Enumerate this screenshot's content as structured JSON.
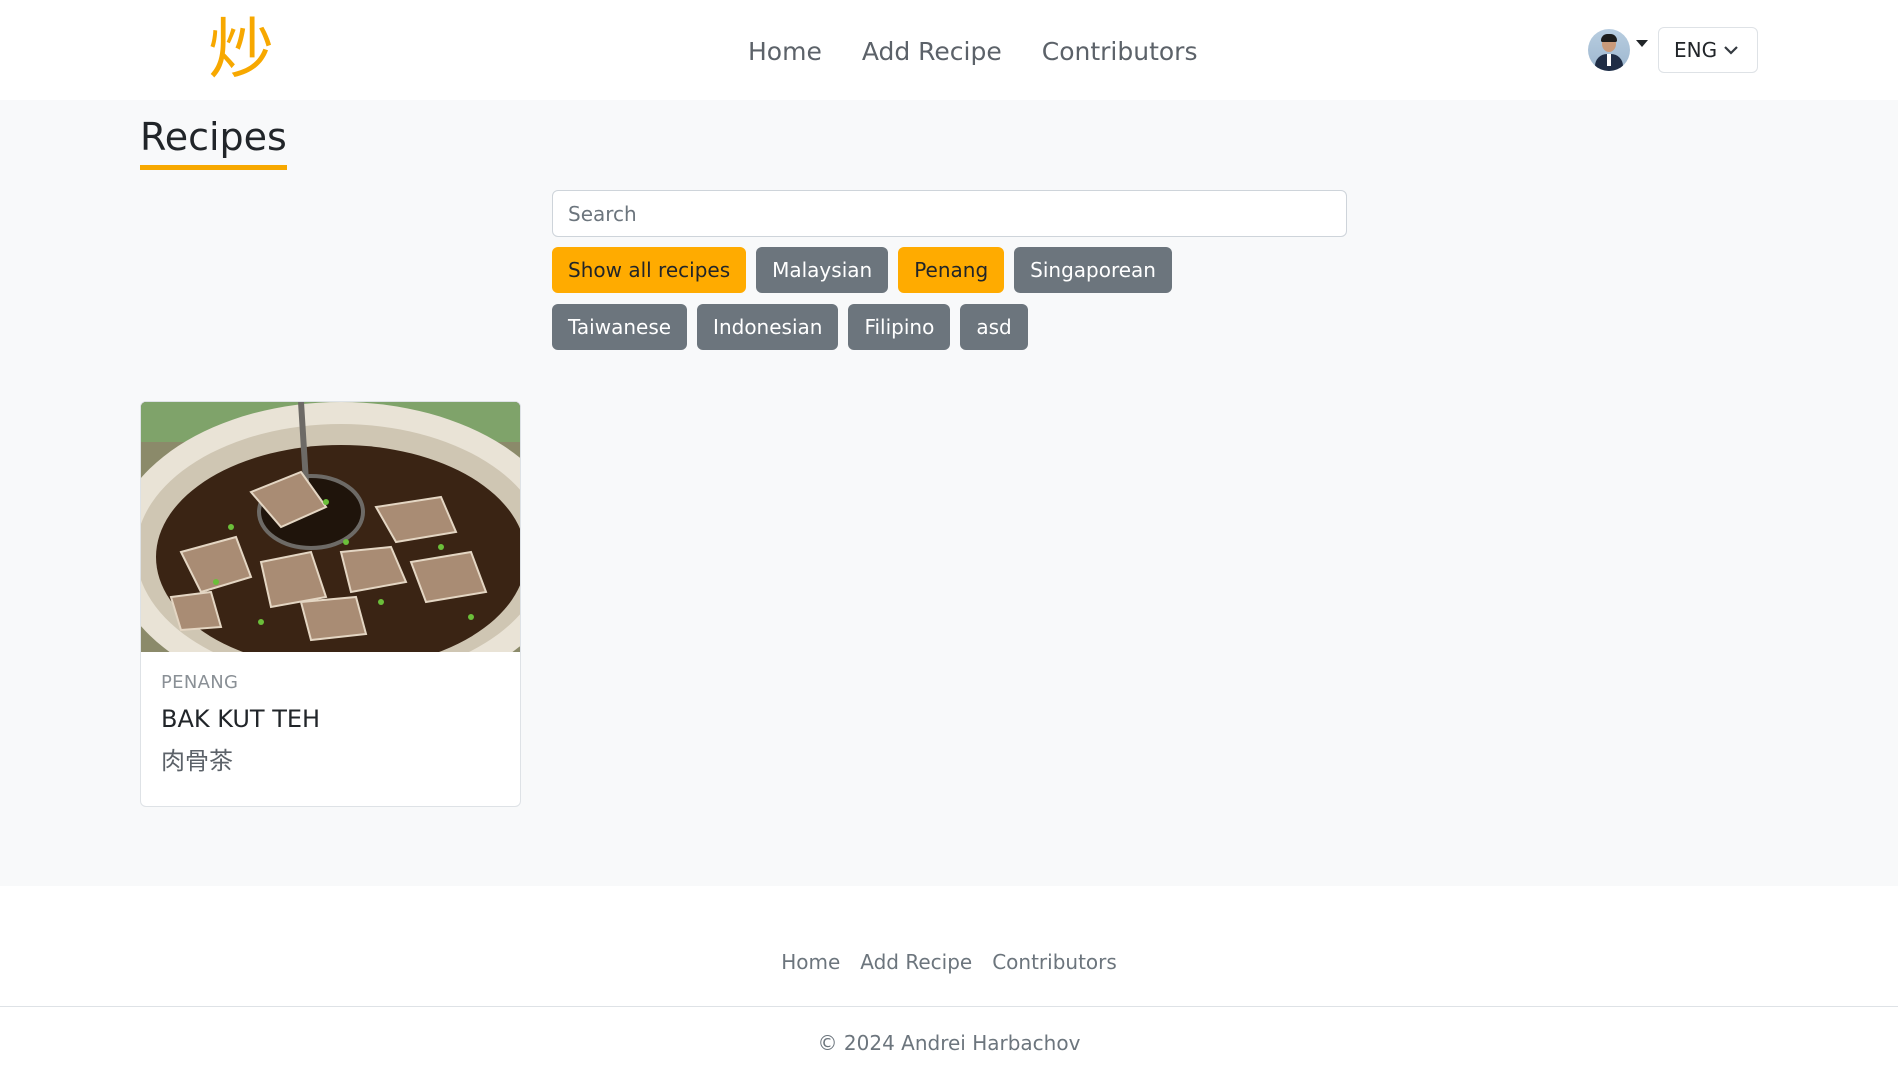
{
  "header": {
    "logo_text": "炒",
    "nav": [
      "Home",
      "Add Recipe",
      "Contributors"
    ],
    "language": "ENG"
  },
  "main": {
    "title": "Recipes",
    "search_placeholder": "Search",
    "filters": [
      {
        "label": "Show all recipes",
        "active": true
      },
      {
        "label": "Malaysian",
        "active": false
      },
      {
        "label": "Penang",
        "active": true
      },
      {
        "label": "Singaporean",
        "active": false
      },
      {
        "label": "Taiwanese",
        "active": false
      },
      {
        "label": "Indonesian",
        "active": false
      },
      {
        "label": "Filipino",
        "active": false
      },
      {
        "label": "asd",
        "active": false
      }
    ],
    "recipes": [
      {
        "region": "PENANG",
        "title": "BAK KUT TEH",
        "subtitle": "肉骨茶"
      }
    ]
  },
  "footer": {
    "nav": [
      "Home",
      "Add Recipe",
      "Contributors"
    ],
    "copyright": "© 2024 Andrei Harbachov"
  },
  "colors": {
    "accent": "#ffab00",
    "chip_inactive": "#6c757d",
    "page_bg": "#f8f9fa"
  }
}
